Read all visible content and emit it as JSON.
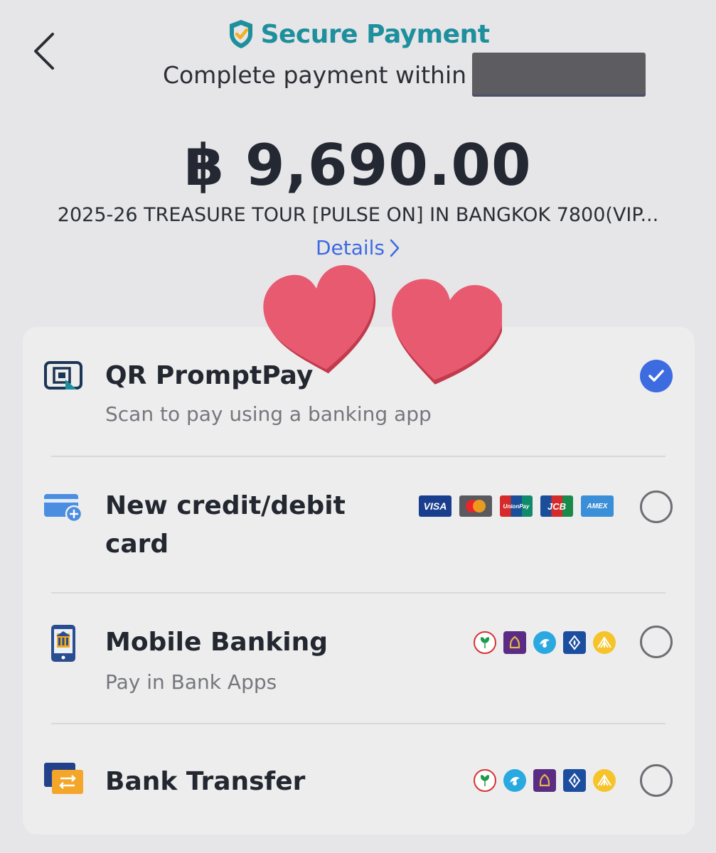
{
  "header": {
    "title": "Secure Payment",
    "subtitle": "Complete payment within"
  },
  "order": {
    "amount": "฿ 9,690.00",
    "event_name": "2025-26 TREASURE TOUR [PULSE ON] IN BANGKOK 7800(VIP...",
    "details_label": "Details"
  },
  "payment_methods": [
    {
      "title": "QR PromptPay",
      "subtitle": "Scan to pay using a banking app",
      "selected": true,
      "icon": "qr-promptpay-icon"
    },
    {
      "title_line1": "New credit/debit",
      "title_line2": "card",
      "selected": false,
      "icon": "credit-card-add-icon",
      "logos": [
        "VISA",
        "Mastercard",
        "UnionPay",
        "JCB",
        "AMEX"
      ]
    },
    {
      "title": "Mobile Banking",
      "subtitle": "Pay in Bank Apps",
      "selected": false,
      "icon": "mobile-bank-icon",
      "logos": [
        "KBank",
        "SCB",
        "Krungthai",
        "Bangkok Bank",
        "Krungsri"
      ]
    },
    {
      "title": "Bank Transfer",
      "selected": false,
      "icon": "bank-transfer-icon",
      "logos": [
        "KBank",
        "Krungthai",
        "SCB",
        "Bangkok Bank",
        "Krungsri"
      ]
    }
  ],
  "colors": {
    "background": "#e6e5e8",
    "brand_teal": "#1e8f9c",
    "link_blue": "#3c6be0",
    "selected_blue": "#3d6be0",
    "heart_pink": "#e85a6f"
  }
}
